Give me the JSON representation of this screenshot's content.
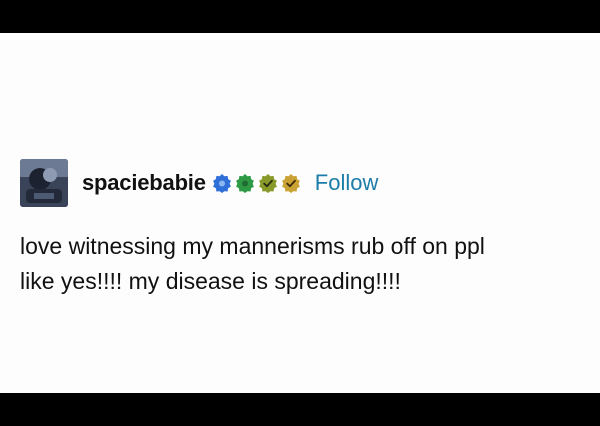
{
  "post": {
    "author": {
      "username": "spaciebabie",
      "avatar": "avatar-image"
    },
    "badges": [
      {
        "icon": "verified-badge-icon",
        "color": "#2f6fd8"
      },
      {
        "icon": "verified-badge-icon",
        "color": "#2e9a45"
      },
      {
        "icon": "checkmark-badge-icon",
        "color": "#8a9a2a"
      },
      {
        "icon": "checkmark-badge-icon",
        "color": "#c9a233"
      }
    ],
    "follow_label": "Follow",
    "body_lines": [
      "love witnessing my mannerisms rub off on ppl",
      "like yes!!!! my disease is spreading!!!!"
    ]
  }
}
